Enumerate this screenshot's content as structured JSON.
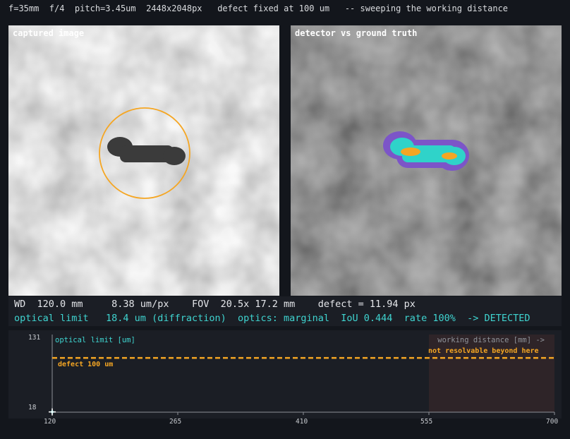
{
  "top_bar": {
    "text": "f=35mm  f/4  pitch=3.45um  2448x2048px   defect fixed at 100 um   -- sweeping the working distance"
  },
  "panels": {
    "left_title": "captured image",
    "right_title": "detector vs ground truth"
  },
  "readout": {
    "line1": "WD  120.0 mm     8.38 um/px    FOV  20.5x 17.2 mm    defect = 11.94 px",
    "line2": "optical limit   18.4 um (diffraction)  optics: marginal  IoU 0.444  rate 100%  -> DETECTED"
  },
  "colors": {
    "background": "#13161c",
    "panel_bg": "#1b1e25",
    "accent_cyan": "#3fd4d0",
    "accent_orange": "#f5a623",
    "mask_purple": "#7c55c8",
    "mask_cyan": "#2fd3c9",
    "not_resolvable_region": "#2e2428"
  },
  "chart_data": {
    "type": "line",
    "title": "optical limit [um]",
    "xlabel": "working distance [mm] ->",
    "ylabel": "",
    "xlim": [
      120,
      700
    ],
    "ylim": [
      18,
      131
    ],
    "x_ticks": [
      "120",
      "265",
      "410",
      "555",
      "700"
    ],
    "y_ticks": [
      "131",
      "18"
    ],
    "series": [
      {
        "name": "optical limit [um]",
        "x": [
          120
        ],
        "y": [
          18.4
        ]
      }
    ],
    "reference_line": {
      "label": "defect 100 um",
      "y": 100
    },
    "shaded_region": {
      "label": "not resolvable beyond here",
      "x_start": 555,
      "x_end": 700
    },
    "current_marker": {
      "x": 120.0,
      "y": 18.4
    }
  }
}
